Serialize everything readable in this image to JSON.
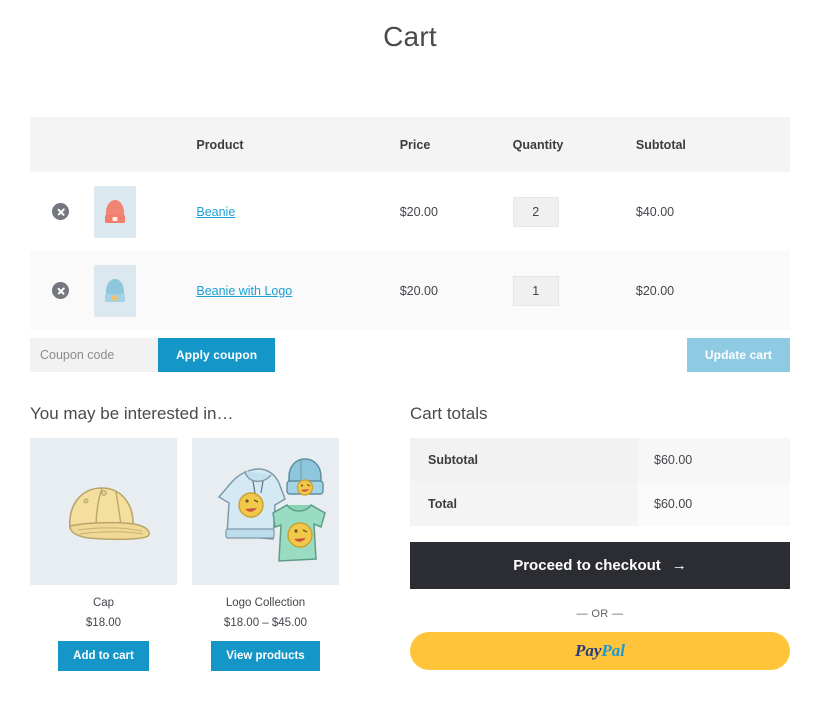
{
  "page": {
    "title": "Cart"
  },
  "cart_table": {
    "headers": {
      "remove": "",
      "thumbnail": "",
      "product": "Product",
      "price": "Price",
      "quantity": "Quantity",
      "subtotal": "Subtotal"
    },
    "rows": [
      {
        "remove_icon": "remove-item-icon",
        "thumb_icon": "beanie-salmon-thumbnail",
        "name": "Beanie",
        "price": "$20.00",
        "quantity": "2",
        "subtotal": "$40.00"
      },
      {
        "remove_icon": "remove-item-icon",
        "thumb_icon": "beanie-with-logo-thumbnail",
        "name": "Beanie with Logo",
        "price": "$20.00",
        "quantity": "1",
        "subtotal": "$20.00"
      }
    ]
  },
  "actions": {
    "coupon_placeholder": "Coupon code",
    "coupon_value": "",
    "apply_coupon_label": "Apply coupon",
    "update_cart_label": "Update cart"
  },
  "upsells": {
    "heading": "You may be interested in…",
    "products": [
      {
        "image_icon": "cap-product-image",
        "title": "Cap",
        "price": "$18.00",
        "button_label": "Add to cart"
      },
      {
        "image_icon": "logo-collection-product-image",
        "title": "Logo Collection",
        "price": "$18.00 – $45.00",
        "button_label": "View products"
      }
    ]
  },
  "totals": {
    "heading": "Cart totals",
    "rows": [
      {
        "label": "Subtotal",
        "value": "$60.00"
      },
      {
        "label": "Total",
        "value": "$60.00"
      }
    ],
    "checkout_label": "Proceed to checkout",
    "checkout_arrow": "→",
    "or_divider": "— OR —",
    "paypal": {
      "pay": "Pay",
      "pal": "Pal"
    }
  },
  "colors": {
    "accent_blue": "#1496c8",
    "disabled_blue": "#8ecbe3",
    "link_blue": "#1ba0d7",
    "checkout_dark": "#2b2d33",
    "paypal_yellow": "#ffc439",
    "paypal_navy": "#253b80",
    "paypal_lightblue": "#179bd7"
  }
}
